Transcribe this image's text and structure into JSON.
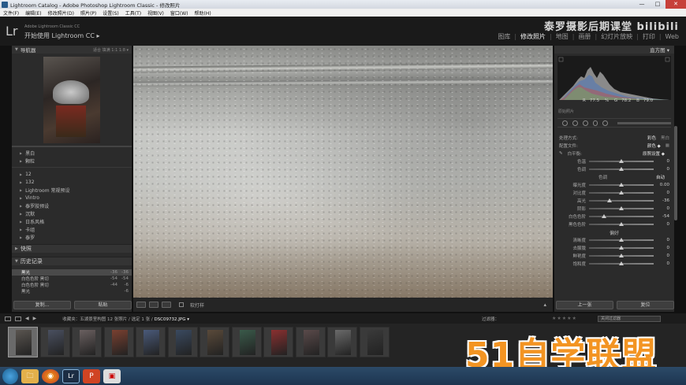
{
  "window": {
    "title": "Lightroom Catalog - Adobe Photoshop Lightroom Classic - 修改照片",
    "controls": [
      "—",
      "□",
      "✕"
    ]
  },
  "menu": [
    "文件(F)",
    "编辑(E)",
    "修改照片(D)",
    "照片(P)",
    "设置(S)",
    "工具(T)",
    "视图(V)",
    "窗口(W)",
    "帮助(H)"
  ],
  "identity": {
    "logo": "Lr",
    "catalog": "Adobe Lightroom Classic CC",
    "plate": "开始使用 Lightroom CC ▸"
  },
  "watermark_top": "泰罗摄影后期课堂 bilibili",
  "modules": [
    "图库",
    "修改照片",
    "地图",
    "画册",
    "幻灯片放映",
    "打印",
    "Web"
  ],
  "left": {
    "navigator": {
      "title": "导航器",
      "zoom": "适合  填满  1:1  1:8 ▾"
    },
    "groups": [
      "黑白",
      "颗粒"
    ],
    "presets": [
      "12",
      "132",
      "Lightroom 常规预设",
      "Vintro",
      "泰罗胶预设",
      "沉默",
      "日系风格",
      "卡组",
      "泰罗"
    ],
    "snapshots_title": "快照",
    "history_title": "历史记录",
    "history": [
      {
        "name": "黑光",
        "a": "-36",
        "b": "-36"
      },
      {
        "name": "白色色阶 黑切",
        "a": "-54",
        "b": "-54"
      },
      {
        "name": "白色色阶 黑切",
        "a": "-44",
        "b": "-6"
      },
      {
        "name": "黑光",
        "a": "",
        "b": "-6"
      }
    ],
    "copy_button": "复制...",
    "paste_button": "粘贴"
  },
  "toolbar": {
    "soft_proof": "软打样"
  },
  "right": {
    "histogram_title": "直方图 ▾",
    "readout": {
      "r_label": "R",
      "r": "77.5",
      "g_label": "G",
      "g": "78.2",
      "b_label": "B",
      "b": "79.0",
      "pct": "%"
    },
    "original": "原始照片",
    "treatment_label": "处理方式:",
    "treatment_color": "彩色",
    "treatment_bw": "黑白",
    "profile_label": "配置文件:",
    "profile_value": "颜色 ◆",
    "wb_label": "白平衡:",
    "wb_value": "原照设置 ◆",
    "wb_rows": [
      {
        "label": "色温",
        "value": "0",
        "pos": 0.5
      },
      {
        "label": "色调",
        "value": "0",
        "pos": 0.5
      }
    ],
    "tone_title": "色调",
    "tone_auto": "自动",
    "tone_rows": [
      {
        "label": "曝光度",
        "value": "0.00",
        "pos": 0.5
      },
      {
        "label": "对比度",
        "value": "0",
        "pos": 0.5
      },
      {
        "label": "高光",
        "value": "-36",
        "pos": 0.32
      },
      {
        "label": "阴影",
        "value": "0",
        "pos": 0.5
      },
      {
        "label": "白色色阶",
        "value": "-54",
        "pos": 0.23
      },
      {
        "label": "黑色色阶",
        "value": "0",
        "pos": 0.5
      }
    ],
    "presence_title": "偏好",
    "presence_rows": [
      {
        "label": "清晰度",
        "value": "0",
        "pos": 0.5
      },
      {
        "label": "去朦胧",
        "value": "0",
        "pos": 0.5
      },
      {
        "label": "鲜艳度",
        "value": "0",
        "pos": 0.5
      },
      {
        "label": "饱和度",
        "value": "0",
        "pos": 0.5
      }
    ],
    "prev_button": "上一张",
    "reset_button": "复位"
  },
  "filmbar": {
    "info": "收藏夹：五湖景室构图  12 张照片 / 选定 1 张 /",
    "filename": "DSC09732.JPG ▾",
    "filter_label": "过滤器：",
    "filter_value": "关闭过滤器"
  },
  "filmstrip_colors": [
    "#5a5550",
    "#4a5060",
    "#6a6060",
    "#7a4030",
    "#4a5a7a",
    "#3a4a60",
    "#5a4a3a",
    "#3a5a4a",
    "#8a3030",
    "#5a4a4a",
    "#6a6a6a",
    "#3a3a3a"
  ],
  "watermark_bottom": "51自学联盟",
  "taskbar": [
    "🗀",
    "◉",
    "Lr",
    "P",
    "▣"
  ]
}
